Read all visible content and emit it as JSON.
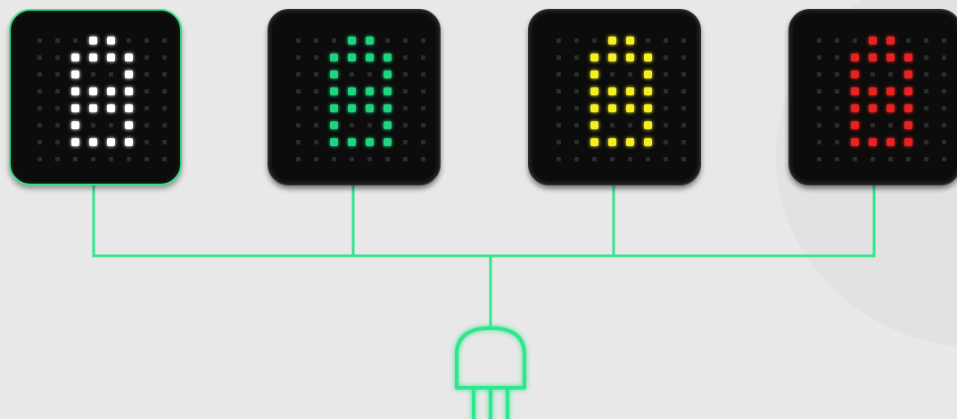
{
  "modules": [
    {
      "id": "white",
      "color": "#ffffff",
      "active": true
    },
    {
      "id": "green",
      "color": "#1fd37f",
      "active": false
    },
    {
      "id": "yellow",
      "color": "#f4ef23",
      "active": false
    },
    {
      "id": "red",
      "color": "#e8221f",
      "active": false
    }
  ],
  "glyph": {
    "character": "8",
    "rows": [
      "00011000",
      "00111100",
      "00100100",
      "00111100",
      "00111100",
      "00100100",
      "00111100",
      "00000000"
    ]
  },
  "connector": {
    "wire_color": "#2fe68c",
    "plug_icon": "power-plug-icon"
  }
}
